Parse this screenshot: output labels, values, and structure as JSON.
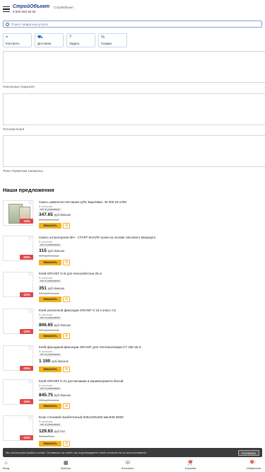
{
  "header": {
    "logo_text": "СтройОбъект",
    "phone": "8 800 555 55 55",
    "site_title": "СтройОбъект"
  },
  "search": {
    "placeholder": "Поиск товара или услуги"
  },
  "quicklinks": [
    {
      "icon": "pin-icon",
      "glyph": "⌖",
      "label": "Контакты"
    },
    {
      "icon": "truck-icon",
      "glyph": "⛟",
      "label": "Доставка"
    },
    {
      "icon": "question-icon",
      "glyph": "?",
      "label": "Задать"
    },
    {
      "icon": "percent-icon",
      "glyph": "%",
      "label": "Скидки"
    }
  ],
  "categories": [
    {
      "label": "Напольные покрытия"
    },
    {
      "label": "Потолки Knauf"
    },
    {
      "label": "Пены Герметики Силиконы"
    }
  ],
  "offers_title": "Наши предложения",
  "products": [
    {
      "name": "Смесь цементно-песчаная ЦПС БирсМикс -М 300 25 кг/60",
      "availability": "В наличии",
      "tag": "нет в упаковках",
      "price": "347.65",
      "unit": "руб./мешок",
      "old_price": "409 руб./мешок",
      "discount": "-15%",
      "order_label": "Заказать",
      "has_image": true
    },
    {
      "name": "Смесь штукатурная МН - СТАРТ КНАУФ сухая на основе гипсового вяжущего",
      "availability": "В наличии",
      "tag": "нет в упаковках",
      "price": "315",
      "unit": "руб./мешок",
      "old_price": "420 руб./мешок",
      "discount": "-25%",
      "order_label": "Заказать",
      "has_image": false
    },
    {
      "name": "Клей GRANIT G-Б для пенозобетона 25 кг",
      "availability": "В наличии",
      "tag": "нет в упаковках",
      "price": "351",
      "unit": "руб./мешок",
      "old_price": "390 руб./мешок",
      "discount": "-10%",
      "order_label": "Заказать",
      "has_image": false
    },
    {
      "name": "Клей усиленной фиксации GRANIT К 23 к класс С2",
      "availability": "В наличии",
      "tag": "нет в упаковках",
      "price": "806.65",
      "unit": "руб./мешок",
      "old_price": "949 руб./мешок",
      "discount": "-15%",
      "order_label": "Заказать",
      "has_image": false
    },
    {
      "name": "Клей фасадный фиксации GRANIT для теплоизоляции СТ 190 25 кг",
      "availability": "В наличии",
      "tag": "нет в упаковках",
      "price": "1 190",
      "unit": "руб./мешок",
      "old_price": "1400 руб./мешок",
      "discount": "-15%",
      "order_label": "Заказать",
      "has_image": false
    },
    {
      "name": "Клей GRANIT К-21 для мозаики и керамогранита белый",
      "availability": "В наличии",
      "tag": "нет в упаковках",
      "price": "845.75",
      "unit": "руб./мешок",
      "old_price": "995 руб./мешок",
      "discount": "-15%",
      "order_label": "Заказать",
      "has_image": false
    },
    {
      "name": "Блок стеновой газобетонный 625х100х250 мм В30 D500",
      "availability": "В наличии",
      "tag": "нет в упаковках",
      "price": "129.63",
      "unit": "руб./шт.",
      "old_price": "144 руб./шт.",
      "discount": "-10%",
      "order_label": "Заказать",
      "has_image": false
    }
  ],
  "cookie": {
    "text": "Мы используем файлы cookie. Оставаясь на сайте, вы подтверждаете своё согласие на их использование.",
    "button": "Согласен"
  },
  "bottom_nav": [
    {
      "icon": "home-icon",
      "glyph": "⌂",
      "label": "Вход"
    },
    {
      "icon": "catalog-icon",
      "glyph": "▦",
      "label": "Каталог"
    },
    {
      "icon": "phone-icon",
      "glyph": "☏",
      "label": "Контакты"
    },
    {
      "icon": "cart-icon",
      "glyph": "🛒",
      "label": "Корзина",
      "badge": "0"
    },
    {
      "icon": "heart-icon",
      "glyph": "♡",
      "label": "Избранное",
      "badge": "0"
    }
  ],
  "colors": {
    "accent": "#1a3b8c",
    "order_button": "#f2b21b",
    "discount": "#e04848"
  }
}
